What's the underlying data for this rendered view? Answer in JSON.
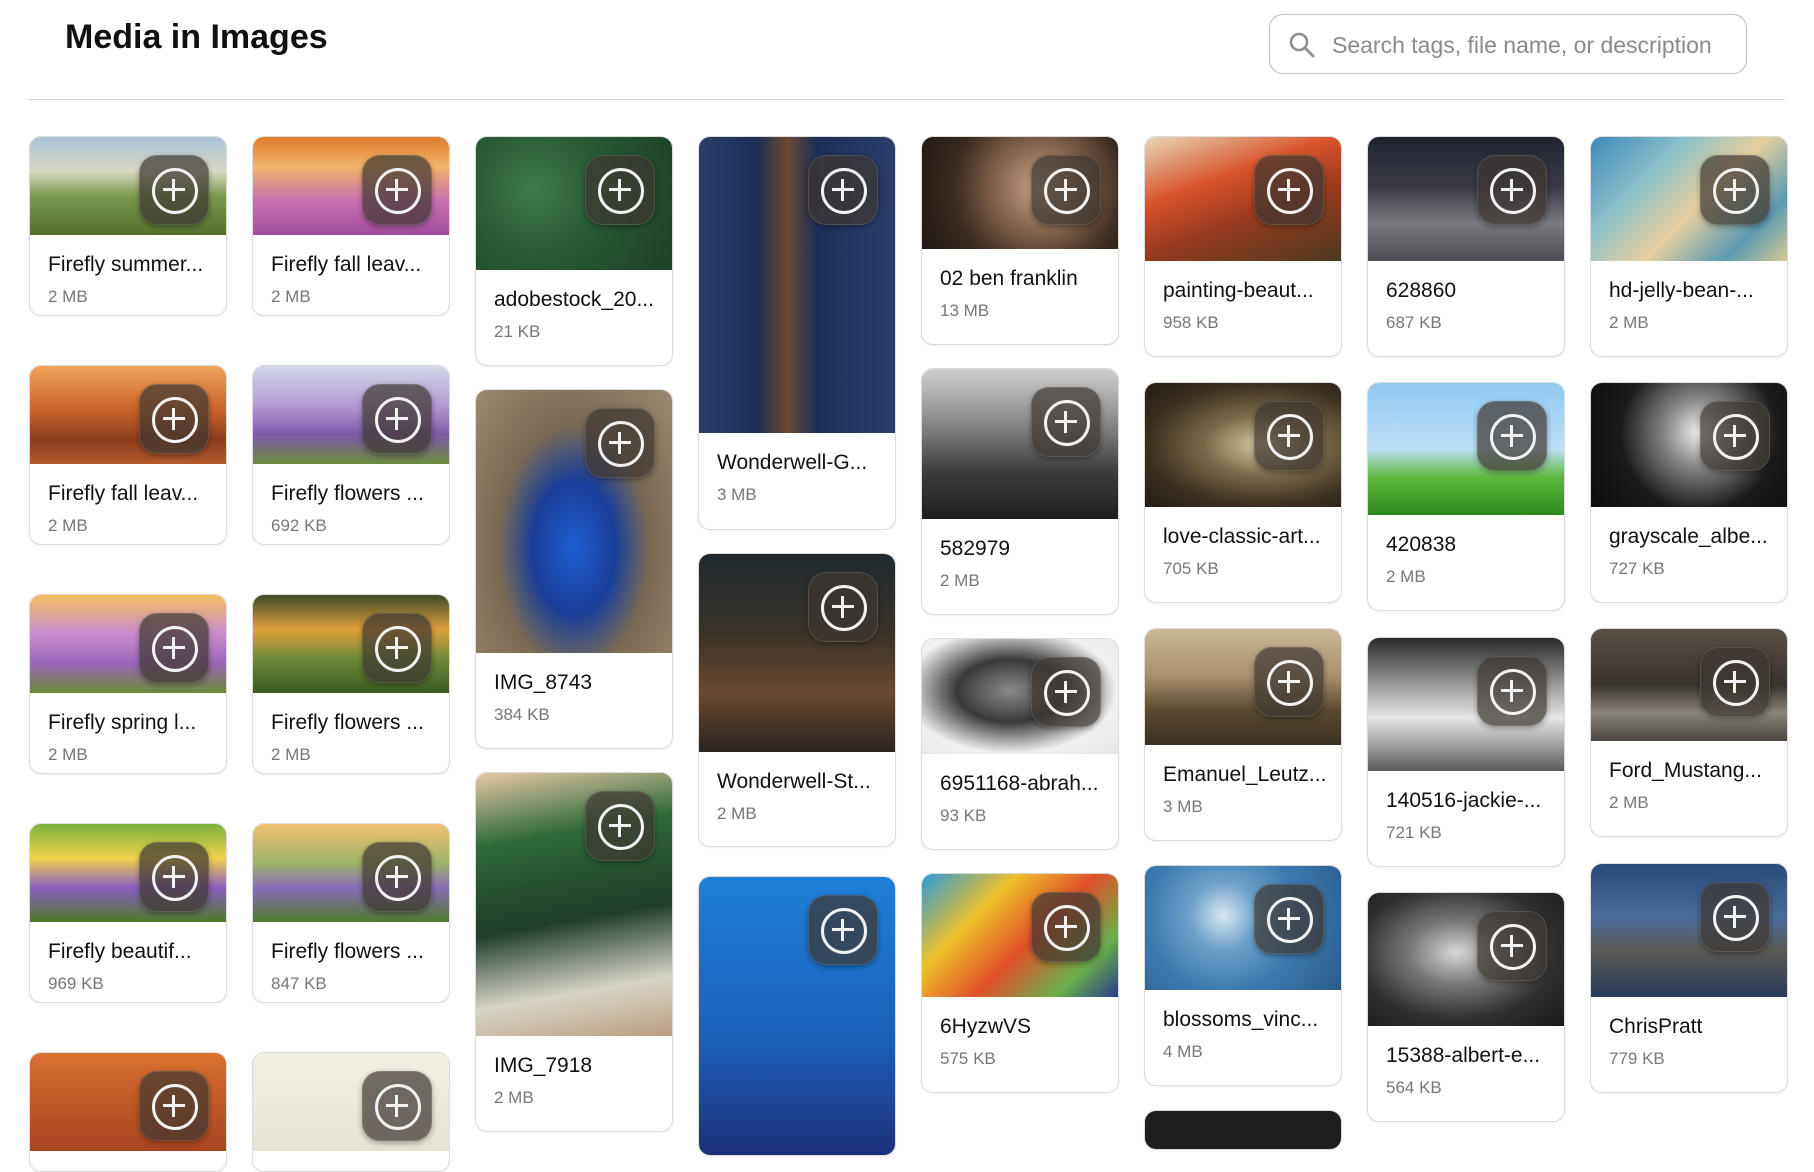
{
  "page": {
    "title": "Media in Images"
  },
  "search": {
    "placeholder": "Search tags, file name, or description",
    "value": ""
  },
  "icons": {
    "search": "search-icon",
    "add": "plus-circle-icon"
  },
  "colors": {
    "add_button_bg": "#3e3832",
    "card_border": "#dcdcdc",
    "divider": "#d7d7d7"
  },
  "grid": {
    "columns": [
      [
        {
          "name": "Firefly summer...",
          "size": "2 MB",
          "image": "summer meadow with purple lupine flowers"
        },
        {
          "name": "Firefly fall leav...",
          "size": "2 MB",
          "image": "autumn trees at sunset"
        },
        {
          "name": "Firefly spring l...",
          "size": "2 MB",
          "image": "spring lilac blossoms"
        },
        {
          "name": "Firefly beautif...",
          "size": "969 KB",
          "image": "colorful wildflowers"
        },
        {
          "name": "",
          "size": "",
          "image": "autumn leaves"
        }
      ],
      [
        {
          "name": "Firefly fall leav...",
          "size": "2 MB",
          "image": "fall leaves over pink flowers"
        },
        {
          "name": "Firefly flowers ...",
          "size": "692 KB",
          "image": "purple flowers"
        },
        {
          "name": "Firefly flowers ...",
          "size": "2 MB",
          "image": "meadow flowers at sunset"
        },
        {
          "name": "Firefly flowers ...",
          "size": "847 KB",
          "image": "purple flowers in field at dawn"
        },
        {
          "name": "",
          "size": "",
          "image": "green logo"
        }
      ],
      [
        {
          "name": "adobestock_20...",
          "size": "21 KB",
          "image": "green leaves"
        },
        {
          "name": "IMG_8743",
          "size": "384 KB",
          "image": "peacock"
        },
        {
          "name": "IMG_7918",
          "size": "2 MB",
          "image": "knit fabric with coffee logo"
        }
      ],
      [
        {
          "name": "Wonderwell-G...",
          "size": "3 MB",
          "image": "graduate in cap and gown"
        },
        {
          "name": "Wonderwell-St...",
          "size": "2 MB",
          "image": "woman at podcast microphone"
        },
        {
          "name": "",
          "size": "",
          "image": "online degrees badge"
        }
      ],
      [
        {
          "name": "02 ben franklin",
          "size": "13 MB",
          "image": "portrait of ben franklin"
        },
        {
          "name": "582979",
          "size": "2 MB",
          "image": "crowd black and white"
        },
        {
          "name": "6951168-abrah...",
          "size": "93 KB",
          "image": "portrait of abraham lincoln"
        },
        {
          "name": "6HyzwVS",
          "size": "575 KB",
          "image": "colorful painted trees"
        }
      ],
      [
        {
          "name": "painting-beaut...",
          "size": "958 KB",
          "image": "autumn landscape painting"
        },
        {
          "name": "love-classic-art...",
          "size": "705 KB",
          "image": "classic painting"
        },
        {
          "name": "Emanuel_Leutz...",
          "size": "3 MB",
          "image": "washington crossing painting"
        },
        {
          "name": "blossoms_vinc...",
          "size": "4 MB",
          "image": "almond blossoms painting"
        },
        {
          "name": "",
          "size": "",
          "image": "dark image"
        }
      ],
      [
        {
          "name": "628860",
          "size": "687 KB",
          "image": "cobblestone street at night"
        },
        {
          "name": "420838",
          "size": "2 MB",
          "image": "green grass and blue sky"
        },
        {
          "name": "140516-jackie-...",
          "size": "721 KB",
          "image": "black and white photo"
        },
        {
          "name": "15388-albert-e...",
          "size": "564 KB",
          "image": "portrait of albert einstein"
        }
      ],
      [
        {
          "name": "hd-jelly-bean-...",
          "size": "2 MB",
          "image": "jelly bean texture"
        },
        {
          "name": "grayscale_albe...",
          "size": "727 KB",
          "image": "grayscale albert einstein"
        },
        {
          "name": "Ford_Mustang...",
          "size": "2 MB",
          "image": "classic mustang car"
        },
        {
          "name": "ChrisPratt",
          "size": "779 KB",
          "image": "man in t-shirt"
        }
      ]
    ]
  }
}
